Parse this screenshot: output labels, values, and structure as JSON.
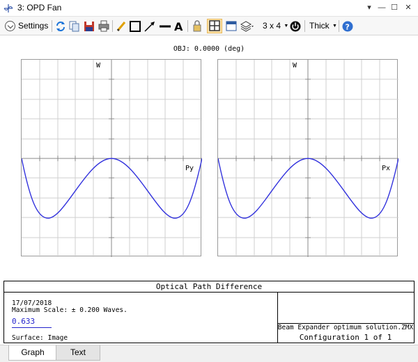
{
  "window": {
    "title": "3: OPD Fan"
  },
  "toolbar": {
    "settings_label": "Settings",
    "layout_label": "3 x 4",
    "thickness_label": "Thick"
  },
  "graph": {
    "obj_label": "OBJ: 0.0000 (deg)",
    "plots": [
      {
        "vertical_label": "W",
        "horizontal_label": "Py"
      },
      {
        "vertical_label": "W",
        "horizontal_label": "Px"
      }
    ],
    "curve_color": "#3333dd"
  },
  "info": {
    "title": "Optical Path Difference",
    "date": "17/07/2018",
    "max_scale": "Maximum Scale: ± 0.200 Waves.",
    "wavelength": "0.633",
    "surface": "Surface: Image",
    "file": "Beam Expander optimum solution.ZMX",
    "config": "Configuration 1 of 1"
  },
  "tabs": [
    {
      "label": "Graph",
      "active": true
    },
    {
      "label": "Text",
      "active": false
    }
  ]
}
